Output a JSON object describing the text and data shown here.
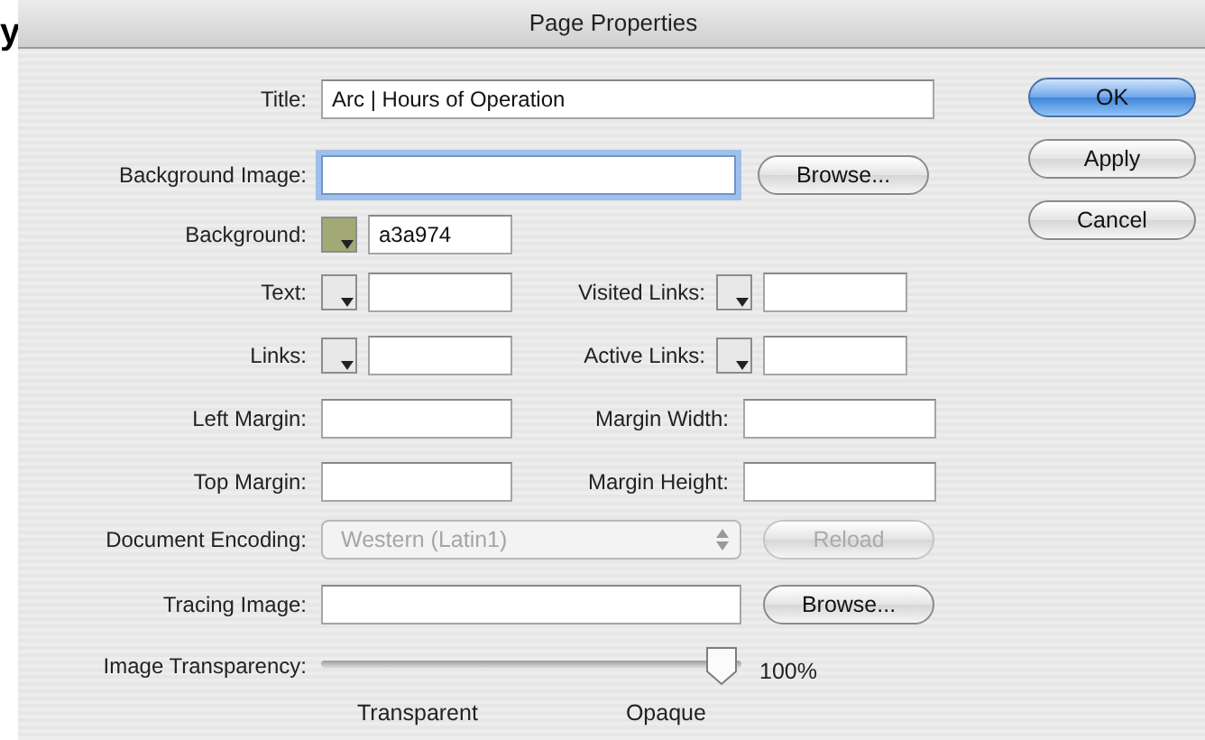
{
  "backdrop_text": "y",
  "window": {
    "title": "Page Properties"
  },
  "title_field": {
    "label": "Title:",
    "value": "Arc | Hours of Operation"
  },
  "background_image": {
    "label": "Background Image:",
    "focused": true,
    "button": "Browse..."
  },
  "background": {
    "label": "Background:",
    "color": "#a3a974",
    "value": "a3a974"
  },
  "color_rows": [
    [
      {
        "label": "Text:"
      },
      {
        "label": "Visited Links:"
      }
    ],
    [
      {
        "label": "Links:"
      },
      {
        "label": "Active Links:"
      }
    ]
  ],
  "margin_rows": [
    [
      {
        "label": "Left Margin:"
      },
      {
        "label": "Margin Width:"
      }
    ],
    [
      {
        "label": "Top Margin:"
      },
      {
        "label": "Margin Height:"
      }
    ]
  ],
  "encoding": {
    "label": "Document Encoding:",
    "value": "Western (Latin1)",
    "disabled": true,
    "button": "Reload"
  },
  "tracing_image": {
    "label": "Tracing Image:",
    "button": "Browse..."
  },
  "transparency": {
    "label": "Image Transparency:",
    "level": 1,
    "reading": "100%",
    "min_label": "Transparent",
    "max_label": "Opaque"
  },
  "buttons": [
    {
      "label": "OK",
      "default": true
    },
    {
      "label": "Apply",
      "default": false
    },
    {
      "label": "Cancel",
      "default": false
    }
  ]
}
